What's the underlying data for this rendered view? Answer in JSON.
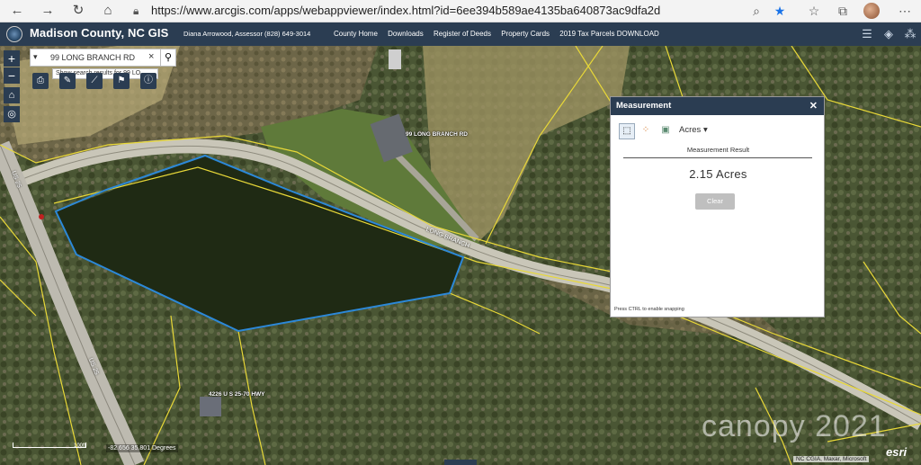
{
  "browser": {
    "url": "https://www.arcgis.com/apps/webappviewer/index.html?id=6ee394b589ae4135ba640873ac9dfa2d"
  },
  "header": {
    "title": "Madison County, NC GIS",
    "assessor": "Diana Arrowood, Assessor (828) 649-3014",
    "links": [
      "County Home",
      "Downloads",
      "Register of Deeds",
      "Property Cards",
      "2019 Tax Parcels DOWNLOAD"
    ]
  },
  "search": {
    "value": "99 LONG BRANCH RD",
    "hint": "Show search results for 99 LO..."
  },
  "measurement": {
    "title": "Measurement",
    "unit": "Acres",
    "result_label": "Measurement Result",
    "result_value": "2.15 Acres",
    "clear_label": "Clear",
    "snap_hint": "Press CTRL to enable snapping"
  },
  "map": {
    "labels": {
      "road_long_branch": "LONG BRANCH",
      "address_99": "99 LONG BRANCH RD",
      "address_4226": "4226 U S 25-70 HWY",
      "hwy_top": "US 25",
      "hwy_bottom": "US 25"
    },
    "coordinates": "-82.656 35.801 Degrees",
    "scale": "100ft",
    "watermark": "canopy 2021",
    "attribution": "NC CGIA, Maxar, Microsoft",
    "logo": "esri"
  }
}
